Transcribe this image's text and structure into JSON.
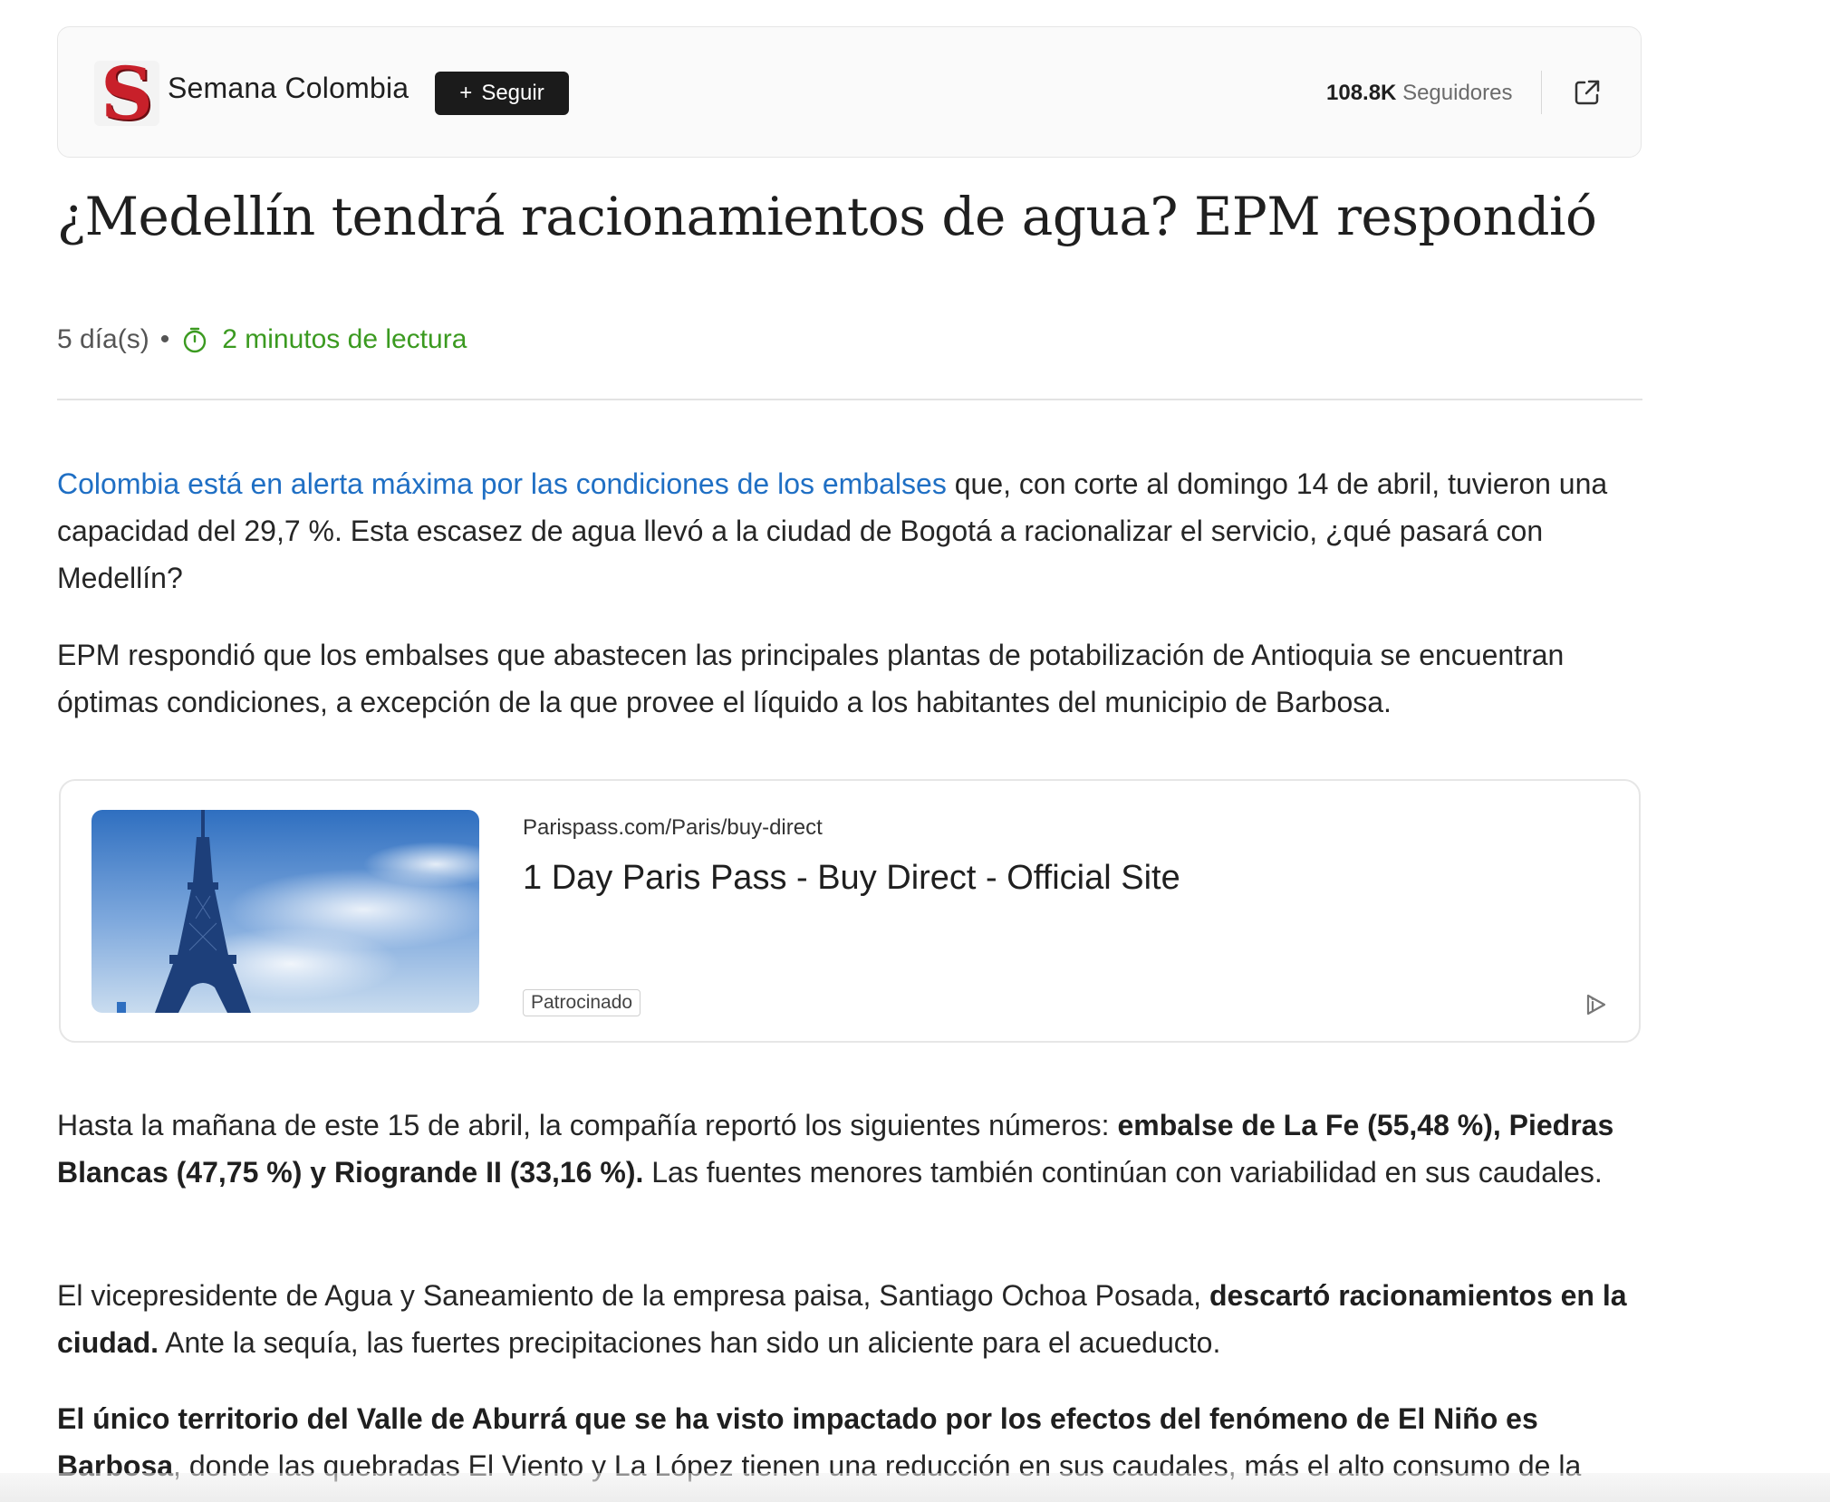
{
  "publisher": {
    "logo_letter": "S",
    "name": "Semana Colombia",
    "follow_label": "Seguir",
    "followers_count": "108.8K",
    "followers_label": "Seguidores",
    "share_icon": "external-link-icon"
  },
  "article": {
    "title": "¿Medellín tendrá racionamientos de agua? EPM respondió",
    "age": "5 día(s)",
    "separator": "•",
    "read_time": "2 minutos de lectura",
    "paragraphs": {
      "p1_link": "Colombia está en alerta máxima por las condiciones de los embalses",
      "p1_rest": " que, con corte al domingo 14 de abril, tuvieron una capacidad del 29,7 %. Esta escasez de agua llevó a la ciudad de Bogotá a racionalizar el servicio, ¿qué pasará con Medellín?",
      "p2": "EPM respondió que los embalses que abastecen las principales plantas de potabilización de Antioquia se encuentran óptimas condiciones, a excepción de la que provee el líquido a los habitantes del municipio de Barbosa.",
      "p3_start": "Hasta la mañana de este 15 de abril, la compañía reportó los siguientes números: ",
      "p3_bold": "embalse de La Fe (55,48 %), Piedras Blancas (47,75 %) y Riogrande II (33,16 %).",
      "p3_end": " Las fuentes menores también continúan con variabilidad en sus caudales.",
      "p4_start": "El vicepresidente de Agua y Saneamiento de la empresa paisa, Santiago Ochoa Posada, ",
      "p4_bold": "descartó racionamientos en la ciudad.",
      "p4_end": " Ante la sequía, las fuertes precipitaciones han sido un aliciente para el acueducto.",
      "p5_bold": "El único territorio del Valle de Aburrá que se ha visto impactado por los efectos del fenómeno de El Niño es Barbosa",
      "p5_rest": ", donde las quebradas El Viento y La López tienen una reducción en sus caudales, más el alto consumo de la"
    }
  },
  "ad": {
    "url": "Parispass.com/Paris/buy-direct",
    "title": "1 Day Paris Pass - Buy Direct - Official Site",
    "badge": "Patrocinado",
    "choice_icon": "ad-choices-icon",
    "image_icon": "eiffel-tower-image"
  },
  "colors": {
    "link": "#1f6fc4",
    "read_time": "#3b9a20",
    "logo_red": "#c8202a",
    "follow_bg": "#1b1b1b"
  }
}
